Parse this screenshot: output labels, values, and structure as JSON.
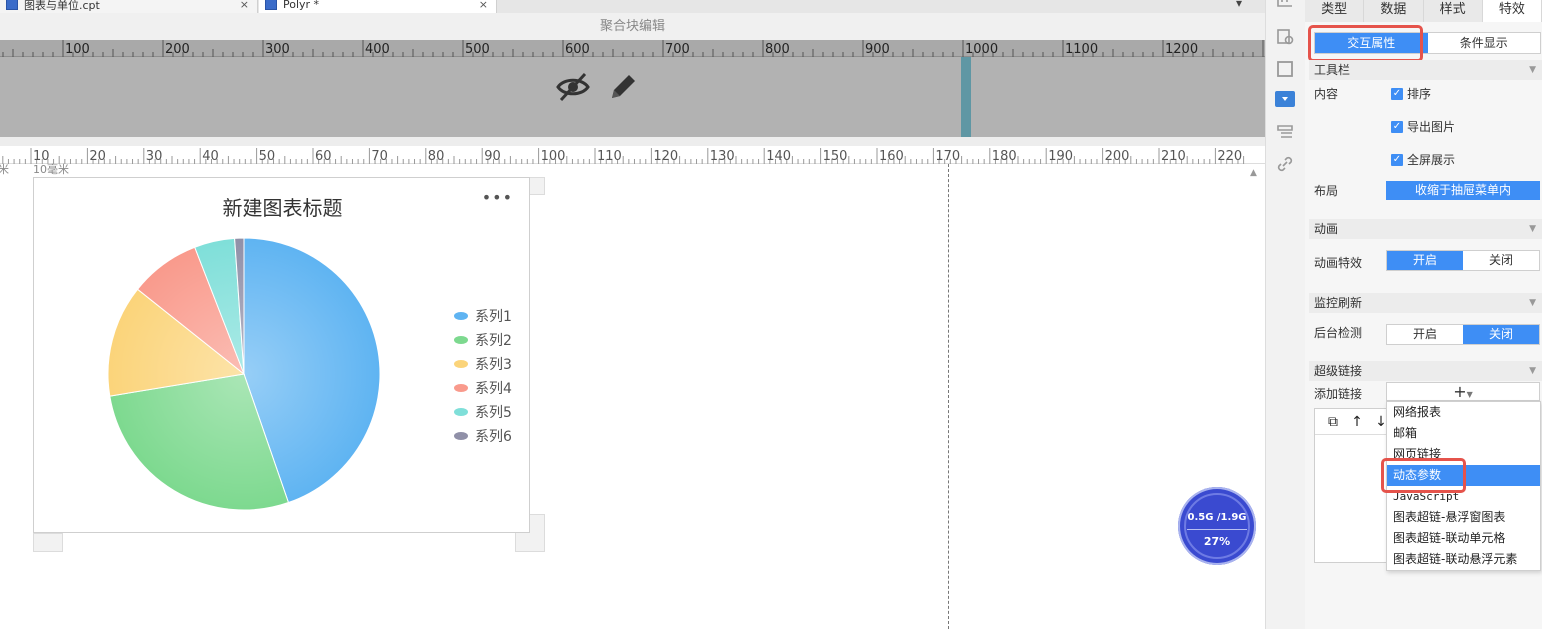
{
  "tabs": [
    {
      "label": "图表与单位.cpt",
      "close": "×"
    },
    {
      "label": "Polyr *",
      "close": "×"
    }
  ],
  "editor": {
    "block_title": "聚合块编辑",
    "top_ruler_ticks": [
      "100",
      "200",
      "300",
      "400",
      "500",
      "600",
      "700",
      "800",
      "900",
      "1000",
      "1100",
      "1200"
    ],
    "mm_ruler_ticks": [
      "10",
      "20",
      "30",
      "40",
      "50",
      "60",
      "70",
      "80",
      "90",
      "100",
      "110",
      "120",
      "130",
      "140",
      "150",
      "160",
      "170",
      "180",
      "190",
      "200",
      "210",
      "220"
    ],
    "unit_label": "10毫米",
    "corner_label": "米"
  },
  "chart": {
    "title": "新建图表标题",
    "menu": "•••"
  },
  "chart_data": {
    "type": "pie",
    "title": "新建图表标题",
    "categories": [
      "系列1",
      "系列2",
      "系列3",
      "系列4",
      "系列5",
      "系列6"
    ],
    "values": [
      44.7,
      27.7,
      13.3,
      8.4,
      4.8,
      1.1
    ],
    "colors": [
      "#5fb4f2",
      "#7dd98f",
      "#fbd47a",
      "#f99a8c",
      "#7fdfd9",
      "#9090a8"
    ],
    "legend_position": "right"
  },
  "memory": {
    "value": "0.5G /1.9G",
    "percent": "27%"
  },
  "panel": {
    "tabs": [
      "类型",
      "数据",
      "样式",
      "特效"
    ],
    "sub_tabs": [
      "交互属性",
      "条件显示"
    ],
    "toolbar": {
      "title": "工具栏",
      "content_label": "内容",
      "checks": [
        "排序",
        "导出图片",
        "全屏展示"
      ],
      "layout_label": "布局",
      "layout_value": "收缩于抽屉菜单内"
    },
    "animation": {
      "title": "动画",
      "label": "动画特效",
      "on": "开启",
      "off": "关闭"
    },
    "monitor": {
      "title": "监控刷新",
      "label": "后台检测",
      "on": "开启",
      "off": "关闭"
    },
    "hyperlink": {
      "title": "超级链接",
      "label": "添加链接",
      "add": "+",
      "list_tools": [
        "⧉",
        "↑",
        "↓"
      ],
      "dropdown": [
        "网络报表",
        "邮箱",
        "网页链接",
        "动态参数",
        "JavaScript",
        "图表超链-悬浮窗图表",
        "图表超链-联动单元格",
        "图表超链-联动悬浮元素"
      ]
    }
  }
}
